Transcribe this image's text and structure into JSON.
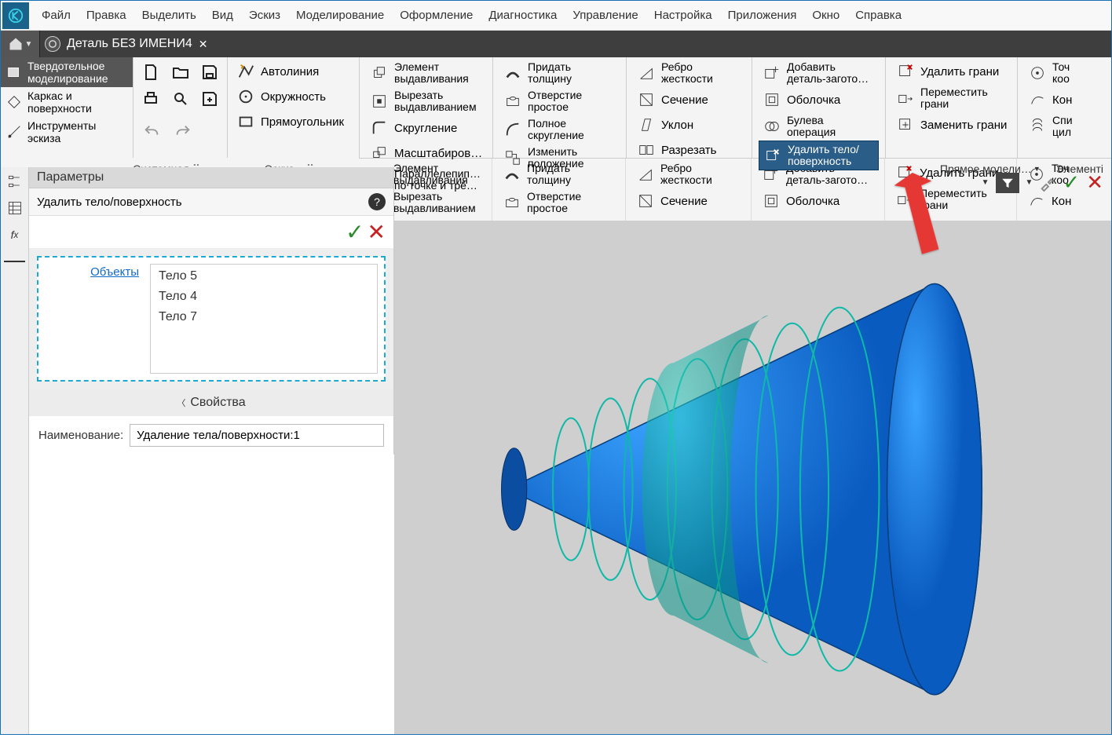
{
  "menu": [
    "Файл",
    "Правка",
    "Выделить",
    "Вид",
    "Эскиз",
    "Моделирование",
    "Оформление",
    "Диагностика",
    "Управление",
    "Настройка",
    "Приложения",
    "Окно",
    "Справка"
  ],
  "doc_tab": {
    "title": "Деталь БЕЗ ИМЕНИ4"
  },
  "modes": {
    "solid": {
      "l1": "Твердотельное",
      "l2": "моделирование"
    },
    "wire": {
      "l1": "Каркас и",
      "l2": "поверхности"
    },
    "sketch": {
      "l1": "Инструменты",
      "l2": "эскиза"
    }
  },
  "section_tabs": {
    "sys": "Системная",
    "sketch": "Эскиз"
  },
  "sketch_tools": {
    "autoline": "Автолиния",
    "circle": "Окружность",
    "rect": "Прямоугольник"
  },
  "feat": {
    "extrude": {
      "l1": "Элемент",
      "l2": "выдавливания"
    },
    "cut": {
      "l1": "Вырезать",
      "l2": "выдавливанием"
    },
    "fillet": "Скругление",
    "scale": "Масштабиров…",
    "box": {
      "l1": "Параллелепип…",
      "l2": "по точке и трё…"
    },
    "thick": {
      "l1": "Придать",
      "l2": "толщину"
    },
    "hole": {
      "l1": "Отверстие",
      "l2": "простое"
    },
    "fullfil": {
      "l1": "Полное",
      "l2": "скругление"
    },
    "repos": {
      "l1": "Изменить",
      "l2": "положение"
    },
    "rib": {
      "l1": "Ребро",
      "l2": "жесткости"
    },
    "sect": "Сечение",
    "draft": "Уклон",
    "split": "Разрезать",
    "addpart": {
      "l1": "Добавить",
      "l2": "деталь-загото…"
    },
    "shell": "Оболочка",
    "bool": {
      "l1": "Булева",
      "l2": "операция"
    },
    "delbody": {
      "l1": "Удалить тело/",
      "l2": "поверхность"
    },
    "delface": "Удалить грани",
    "moveface": {
      "l1": "Переместить",
      "l2": "грани"
    },
    "replface": "Заменить грани",
    "point": {
      "l1": "Точ",
      "l2": "коо"
    },
    "contour": "Кон",
    "spiral": {
      "l1": "Спи",
      "l2": "цил"
    }
  },
  "ribbon_caption": "Элементы тела",
  "right_tabs": {
    "direct": "Прямое модели…",
    "elem": "Элементі"
  },
  "panel": {
    "title": "Параметры",
    "subtitle": "Удалить тело/поверхность",
    "objects_label": "Объекты",
    "objects": [
      "Тело 5",
      "Тело 4",
      "Тело 7"
    ],
    "props_header": "Свойства",
    "name_label": "Наименование:",
    "name_value": "Удаление тела/поверхности:1"
  }
}
